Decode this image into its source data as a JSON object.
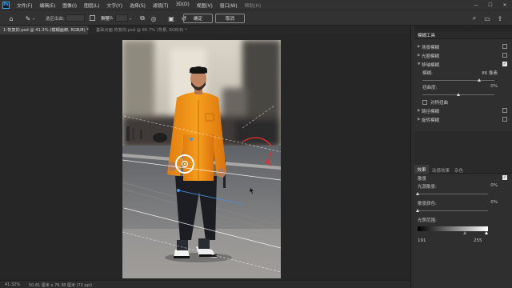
{
  "app": {
    "logo_text": "Ps"
  },
  "menu": {
    "items": [
      "文件(F)",
      "编辑(E)",
      "图像(I)",
      "图层(L)",
      "文字(Y)",
      "选择(S)",
      "滤镜(T)",
      "3D(D)",
      "视图(V)",
      "窗口(W)",
      "帮助(H)"
    ]
  },
  "window_controls": {
    "minimize": "—",
    "maximize": "☐",
    "close": "✕"
  },
  "options": {
    "selection_label": "选区出血:",
    "selection_value": "",
    "noise_label": "数量:",
    "noise_value": "100%",
    "ok_label": "确定",
    "cancel_label": "取消"
  },
  "tabs": [
    {
      "label": "1-恢复的.psd @ 41.3% (模糊画廊, RGB/8) *",
      "active": true
    },
    {
      "label": "基础对面-恢复的.psd @ 80.7% (背景, RGB/8) *",
      "active": false
    }
  ],
  "blur_tools": {
    "title": "模糊工具",
    "items": [
      {
        "label": "场景模糊",
        "expanded": false,
        "checked": false
      },
      {
        "label": "光圈模糊",
        "expanded": false,
        "checked": false
      },
      {
        "label": "移轴模糊",
        "expanded": true,
        "checked": true
      },
      {
        "label": "路径模糊",
        "expanded": false,
        "checked": false
      },
      {
        "label": "旋转模糊",
        "expanded": false,
        "checked": false
      }
    ],
    "tilt_params": {
      "blur_label": "模糊:",
      "blur_value": "86 像素",
      "blur_level": 0.79,
      "distortion_label": "扭曲度:",
      "distortion_value": "0%",
      "distortion_level": 0.5,
      "symmetric_label": "对称扭曲",
      "symmetric_checked": false
    }
  },
  "effects": {
    "tabs": [
      "效果",
      "动感效果",
      "杂色"
    ],
    "bokeh_label": "散景",
    "bokeh_checked": true,
    "bokeh_brightness_label": "光源散景:",
    "bokeh_brightness_value": "0%",
    "bokeh_brightness_level": 0.0,
    "bokeh_color_label": "散景颜色:",
    "bokeh_color_value": "0%",
    "bokeh_color_level": 0.0,
    "light_range_label": "光照范围:",
    "light_range_min": "191",
    "light_range_max": "255"
  },
  "status": {
    "zoom": "41.32%",
    "doc_info": "50.81 厘米 x 76.38 厘米 (72 ppi)"
  },
  "colors": {
    "accent": "#31a8ff",
    "pin_ring": "#ffffff",
    "pin_line": "#4a90e2",
    "arrow_red": "#e03030"
  }
}
